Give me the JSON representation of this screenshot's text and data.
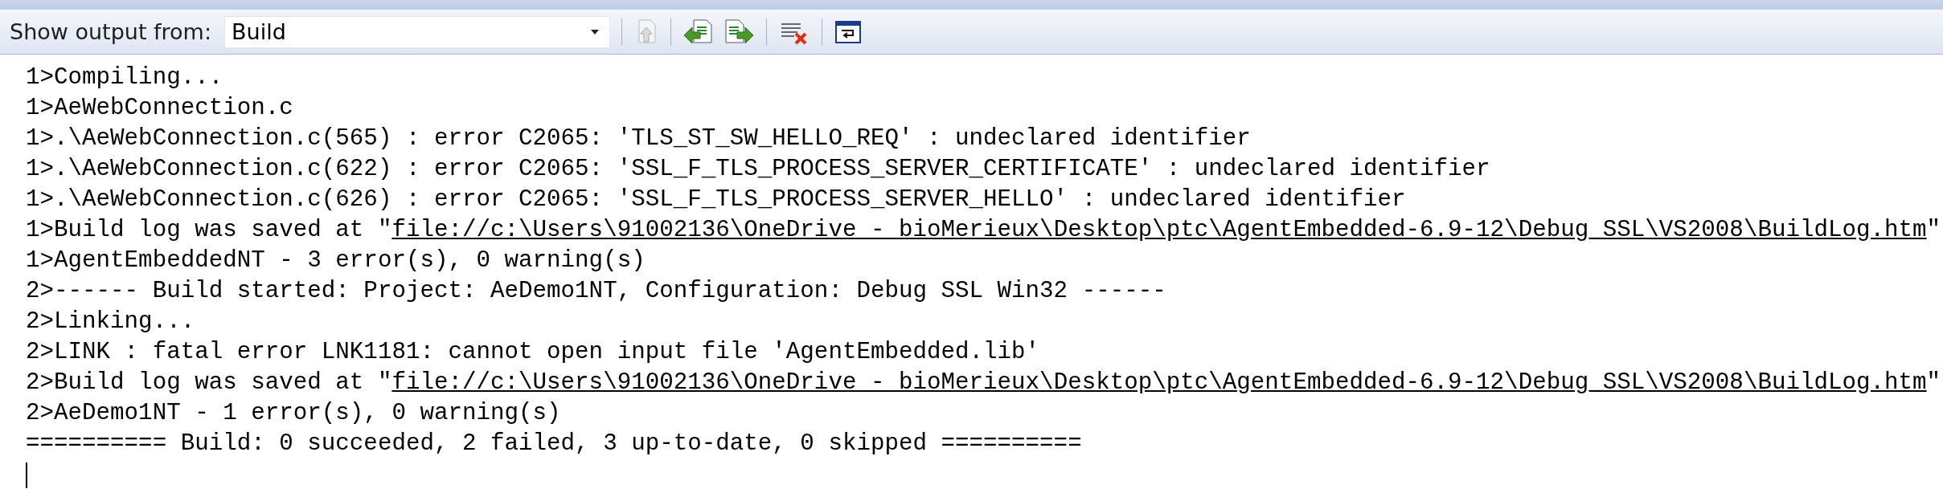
{
  "toolbar": {
    "label": "Show output from:",
    "source": {
      "value": "Build"
    }
  },
  "output_lines": [
    {
      "text": "1>Compiling..."
    },
    {
      "text": "1>AeWebConnection.c"
    },
    {
      "text": "1>.\\AeWebConnection.c(565) : error C2065: 'TLS_ST_SW_HELLO_REQ' : undeclared identifier"
    },
    {
      "text": "1>.\\AeWebConnection.c(622) : error C2065: 'SSL_F_TLS_PROCESS_SERVER_CERTIFICATE' : undeclared identifier"
    },
    {
      "text": "1>.\\AeWebConnection.c(626) : error C2065: 'SSL_F_TLS_PROCESS_SERVER_HELLO' : undeclared identifier"
    },
    {
      "text": "1>Build log was saved at \"",
      "link": "file://c:\\Users\\91002136\\OneDrive - bioMerieux\\Desktop\\ptc\\AgentEmbedded-6.9-12\\Debug_SSL\\VS2008\\BuildLog.htm",
      "after": "\""
    },
    {
      "text": "1>AgentEmbeddedNT - 3 error(s), 0 warning(s)"
    },
    {
      "text": "2>------ Build started: Project: AeDemo1NT, Configuration: Debug SSL Win32 ------"
    },
    {
      "text": "2>Linking..."
    },
    {
      "text": "2>LINK : fatal error LNK1181: cannot open input file 'AgentEmbedded.lib'"
    },
    {
      "text": "2>Build log was saved at \"",
      "link": "file://c:\\Users\\91002136\\OneDrive - bioMerieux\\Desktop\\ptc\\AgentEmbedded-6.9-12\\Debug_SSL\\VS2008\\BuildLog.htm",
      "after": "\""
    },
    {
      "text": "2>AeDemo1NT - 1 error(s), 0 warning(s)"
    },
    {
      "text": "========== Build: 0 succeeded, 2 failed, 3 up-to-date, 0 skipped =========="
    }
  ]
}
